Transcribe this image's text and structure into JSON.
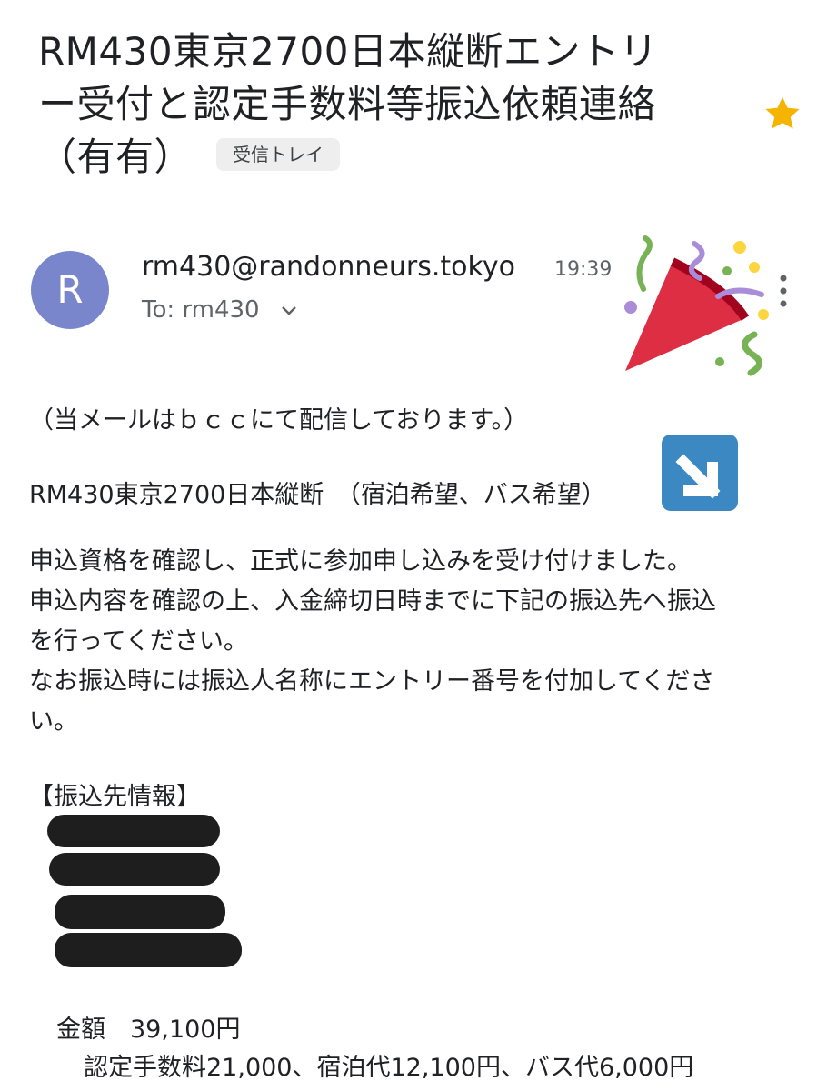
{
  "email": {
    "subject_line1": "RM430東京2700日本縦断エントリ",
    "subject_line2": "ー受付と認定手数料等振込依頼連絡",
    "subject_line3": "（有有）",
    "label_chip": "受信トレイ",
    "sender_initial": "R",
    "sender": "rm430@randonneurs.tokyo",
    "time": "19:39",
    "to": "To: rm430",
    "body": {
      "notice": "（当メールはｂｃｃにて配信しております。）",
      "event": "RM430東京2700日本縦断　（宿泊希望、バス希望）",
      "para_lines": [
        "申込資格を確認し、正式に参加申し込みを受け付けました。",
        "申込内容を確認の上、入金締切日時までに下記の振込先へ振込",
        "を行ってください。",
        "なお振込時には振込人名称にエントリー番号を付加してくださ",
        "い。"
      ],
      "bank_header": "【振込先情報】",
      "amount": "金額　39,100円",
      "breakdown": "認定手数料21,000、宿泊代12,100円、バス代6,000円"
    }
  },
  "icons": [
    "star-icon",
    "chevron-down-icon",
    "more-vert-icon",
    "party-popper-icon",
    "down-arrow-icon"
  ],
  "colors": {
    "avatar": "#7986cb",
    "star": "#f4b400",
    "arrow_box": "#3b88c3"
  }
}
